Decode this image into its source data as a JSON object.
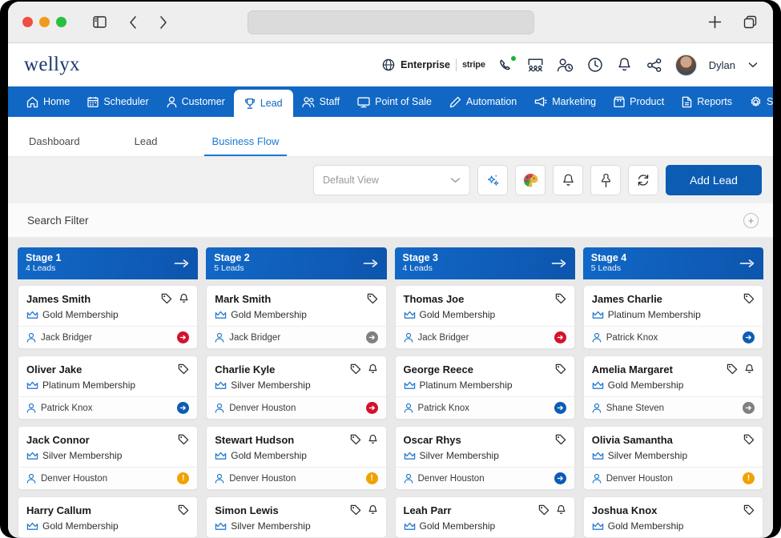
{
  "browser": {
    "traffic_lights": [
      "close",
      "minimize",
      "maximize"
    ],
    "sidebar_icon": "sidebar-toggle-icon",
    "back_icon": "chevron-left-icon",
    "forward_icon": "chevron-right-icon",
    "url_value": "",
    "new_tab_icon": "plus-icon",
    "tab_overview_icon": "copy-tabs-icon"
  },
  "header": {
    "logo": "wellyx",
    "plan_label": "Enterprise",
    "payment_label": "stripe",
    "globe_icon": "globe-icon",
    "icons": [
      "phone-icon",
      "class-board-icon",
      "member-clock-icon",
      "clock-icon",
      "bell-icon",
      "share-icon"
    ],
    "user_name": "Dylan",
    "chevron_icon": "chevron-down-icon"
  },
  "nav": {
    "items": [
      {
        "label": "Home",
        "icon": "home-icon",
        "active": false
      },
      {
        "label": "Scheduler",
        "icon": "calendar-icon",
        "active": false
      },
      {
        "label": "Customer",
        "icon": "person-icon",
        "active": false
      },
      {
        "label": "Lead",
        "icon": "trophy-icon",
        "active": true
      },
      {
        "label": "Staff",
        "icon": "people-icon",
        "active": false
      },
      {
        "label": "Point of Sale",
        "icon": "monitor-icon",
        "active": false
      },
      {
        "label": "Automation",
        "icon": "pen-icon",
        "active": false
      },
      {
        "label": "Marketing",
        "icon": "megaphone-icon",
        "active": false
      },
      {
        "label": "Product",
        "icon": "box-icon",
        "active": false
      },
      {
        "label": "Reports",
        "icon": "report-icon",
        "active": false
      },
      {
        "label": "Setup",
        "icon": "gear-icon",
        "active": false
      }
    ],
    "search_icon": "search-icon"
  },
  "tabs": [
    {
      "label": "Dashboard",
      "active": false
    },
    {
      "label": "Lead",
      "active": false
    },
    {
      "label": "Business Flow",
      "active": true
    }
  ],
  "toolbar": {
    "view_value": "Default View",
    "view_placeholder": "Default View",
    "buttons": [
      {
        "name": "ai-star-button",
        "icon": "sparkle-star-icon"
      },
      {
        "name": "palette-button",
        "icon": "color-palette-icon"
      },
      {
        "name": "notification-button",
        "icon": "bell-icon"
      },
      {
        "name": "pin-button",
        "icon": "pin-icon"
      },
      {
        "name": "refresh-button",
        "icon": "refresh-icon"
      }
    ],
    "add_lead_label": "Add Lead"
  },
  "search_filter": {
    "label": "Search Filter",
    "expand_icon": "plus-circle-icon"
  },
  "board": {
    "columns": [
      {
        "title": "Stage 1",
        "count": "4 Leads",
        "arrow_icon": "arrow-right-icon",
        "cards": [
          {
            "name": "James Smith",
            "membership": "Gold Membership",
            "owner": "Jack Bridger",
            "tag": true,
            "bell": true,
            "badge": "red"
          },
          {
            "name": "Oliver Jake",
            "membership": "Platinum Membership",
            "owner": "Patrick Knox",
            "tag": true,
            "bell": false,
            "badge": "blue"
          },
          {
            "name": "Jack Connor",
            "membership": "Silver Membership",
            "owner": "Denver Houston",
            "tag": true,
            "bell": false,
            "badge": "amber"
          },
          {
            "name": "Harry Callum",
            "membership": "Gold Membership",
            "owner": "",
            "tag": true,
            "bell": false,
            "badge": ""
          }
        ]
      },
      {
        "title": "Stage 2",
        "count": "5 Leads",
        "arrow_icon": "arrow-right-icon",
        "cards": [
          {
            "name": "Mark Smith",
            "membership": "Gold Membership",
            "owner": "Jack Bridger",
            "tag": true,
            "bell": false,
            "badge": "gray"
          },
          {
            "name": "Charlie Kyle",
            "membership": "Silver Membership",
            "owner": "Denver Houston",
            "tag": true,
            "bell": true,
            "badge": "red"
          },
          {
            "name": "Stewart Hudson",
            "membership": "Gold Membership",
            "owner": "Denver Houston",
            "tag": true,
            "bell": true,
            "badge": "amber"
          },
          {
            "name": "Simon Lewis",
            "membership": "Silver Membership",
            "owner": "",
            "tag": true,
            "bell": true,
            "badge": ""
          }
        ]
      },
      {
        "title": "Stage 3",
        "count": "4 Leads",
        "arrow_icon": "arrow-right-icon",
        "cards": [
          {
            "name": "Thomas Joe",
            "membership": "Gold Membership",
            "owner": "Jack Bridger",
            "tag": true,
            "bell": false,
            "badge": "red"
          },
          {
            "name": "George Reece",
            "membership": "Platinum Membership",
            "owner": "Patrick Knox",
            "tag": true,
            "bell": false,
            "badge": "blue"
          },
          {
            "name": "Oscar Rhys",
            "membership": "Silver Membership",
            "owner": "Denver Houston",
            "tag": true,
            "bell": false,
            "badge": "blue"
          },
          {
            "name": "Leah Parr",
            "membership": "Gold Membership",
            "owner": "",
            "tag": true,
            "bell": true,
            "badge": ""
          }
        ]
      },
      {
        "title": "Stage 4",
        "count": "5 Leads",
        "arrow_icon": "arrow-right-icon",
        "cards": [
          {
            "name": "James Charlie",
            "membership": "Platinum Membership",
            "owner": "Patrick Knox",
            "tag": true,
            "bell": false,
            "badge": "blue"
          },
          {
            "name": "Amelia Margaret",
            "membership": "Gold Membership",
            "owner": "Shane Steven",
            "tag": true,
            "bell": true,
            "badge": "gray"
          },
          {
            "name": "Olivia Samantha",
            "membership": "Silver Membership",
            "owner": "Denver Houston",
            "tag": true,
            "bell": false,
            "badge": "amber"
          },
          {
            "name": "Joshua Knox",
            "membership": "Gold Membership",
            "owner": "",
            "tag": true,
            "bell": false,
            "badge": ""
          }
        ]
      }
    ]
  },
  "colors": {
    "nav_blue": "#1167c4",
    "accent_blue": "#0d5cb3",
    "tab_active": "#1a7ad4",
    "badge_red": "#d2122e",
    "badge_amber": "#f0a202",
    "logo_navy": "#1b3a6b"
  }
}
